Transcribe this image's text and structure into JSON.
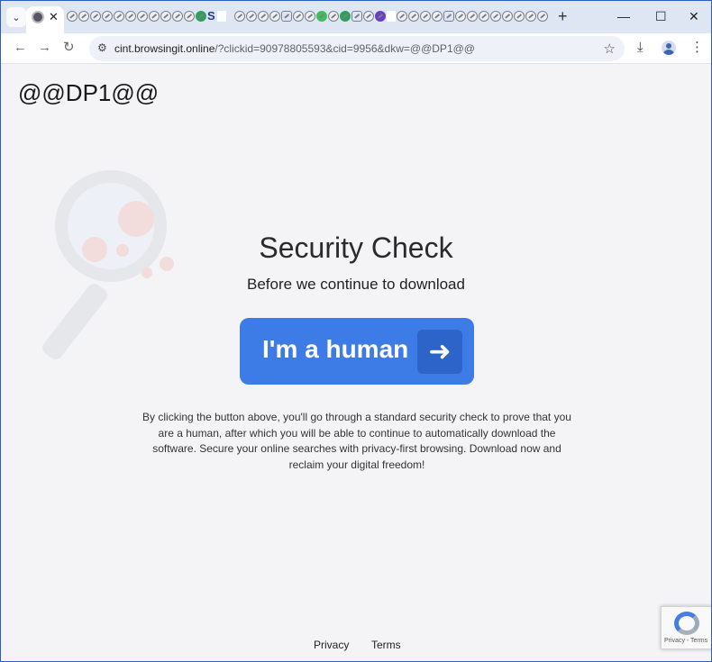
{
  "browser": {
    "tab_close": "✕",
    "tab_list_icon": "chevron-down-icon",
    "new_tab": "+",
    "window_controls": {
      "minimize": "—",
      "maximize": "☐",
      "close": "✕"
    },
    "url_host": "cint.browsingit.online",
    "url_path": "/?clickid=90978805593&cid=9956&dkw=@@DP1@@"
  },
  "page": {
    "site_title": "@@DP1@@",
    "heading": "Security Check",
    "subheading": "Before we continue to download",
    "human_button_label": "I'm a human",
    "human_button_arrow": "➜",
    "disclaimer": "By clicking the button above, you'll go through a standard security check to prove that you are a human, after which you will be able to continue to automatically download the software. Secure your online searches with privacy-first browsing. Download now and reclaim your digital freedom!",
    "footer_privacy": "Privacy",
    "footer_terms": "Terms",
    "recaptcha_text": "Privacy - Terms"
  },
  "colors": {
    "accent": "#3d7ce6",
    "accent_dark": "#2c64c9",
    "background": "#f4f4f7"
  }
}
